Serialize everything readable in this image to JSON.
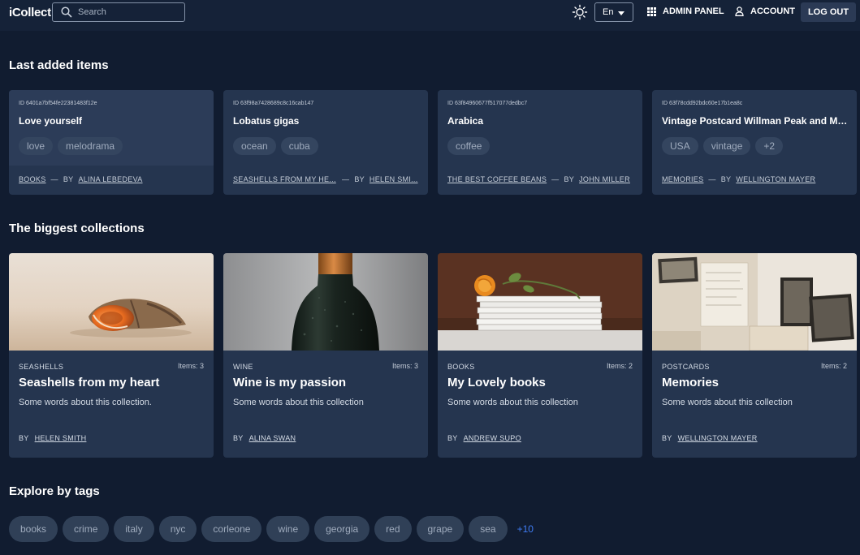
{
  "header": {
    "logo": "iCollect",
    "search_placeholder": "Search",
    "language": "En",
    "admin_panel": "ADMIN PANEL",
    "account": "ACCOUNT",
    "logout": "LOG OUT"
  },
  "sections": {
    "last_added": "Last added items",
    "biggest": "The biggest collections",
    "tags": "Explore by tags"
  },
  "items": [
    {
      "id": "ID 6401a7bf54fe22381483f12e",
      "name": "Love yourself",
      "tags": [
        "love",
        "melodrama"
      ],
      "collection": "BOOKS",
      "by": "BY",
      "author": "ALINA LEBEDEVA"
    },
    {
      "id": "ID 63f98a7428689c8c16cab147",
      "name": "Lobatus gigas",
      "tags": [
        "ocean",
        "cuba"
      ],
      "collection": "SEASHELLS FROM MY HE...",
      "by": "BY",
      "author": "HELEN SMI..."
    },
    {
      "id": "ID 63f84960677f517077dedbc7",
      "name": "Arabica",
      "tags": [
        "coffee"
      ],
      "collection": "THE BEST COFFEE BEANS",
      "by": "BY",
      "author": "JOHN MILLER"
    },
    {
      "id": "ID 63f78cdd92bdc60e17b1ea8c",
      "name": "Vintage Postcard Willman Peak and Mo...",
      "tags": [
        "USA",
        "vintage",
        "+2"
      ],
      "collection": "MEMORIES",
      "by": "BY",
      "author": "WELLINGTON MAYER"
    }
  ],
  "collections": [
    {
      "category": "SEASHELLS",
      "count": "Items: 3",
      "title": "Seashells from my heart",
      "description": "Some words about this collection.",
      "by": "BY",
      "author": "HELEN SMITH"
    },
    {
      "category": "WINE",
      "count": "Items: 3",
      "title": "Wine is my passion",
      "description": "Some words about this collection",
      "by": "BY",
      "author": "ALINA SWAN"
    },
    {
      "category": "BOOKS",
      "count": "Items: 2",
      "title": "My Lovely books",
      "description": "Some words about this collection",
      "by": "BY",
      "author": "ANDREW SUPO"
    },
    {
      "category": "POSTCARDS",
      "count": "Items: 2",
      "title": "Memories",
      "description": "Some words about this collection",
      "by": "BY",
      "author": "WELLINGTON MAYER"
    }
  ],
  "tags": [
    "books",
    "crime",
    "italy",
    "nyc",
    "corleone",
    "wine",
    "georgia",
    "red",
    "grape",
    "sea"
  ],
  "more_tags": "+10",
  "colors": {
    "background": "#111c30",
    "header": "#152238",
    "card": "#25354f",
    "accent": "#3f7cf3"
  }
}
